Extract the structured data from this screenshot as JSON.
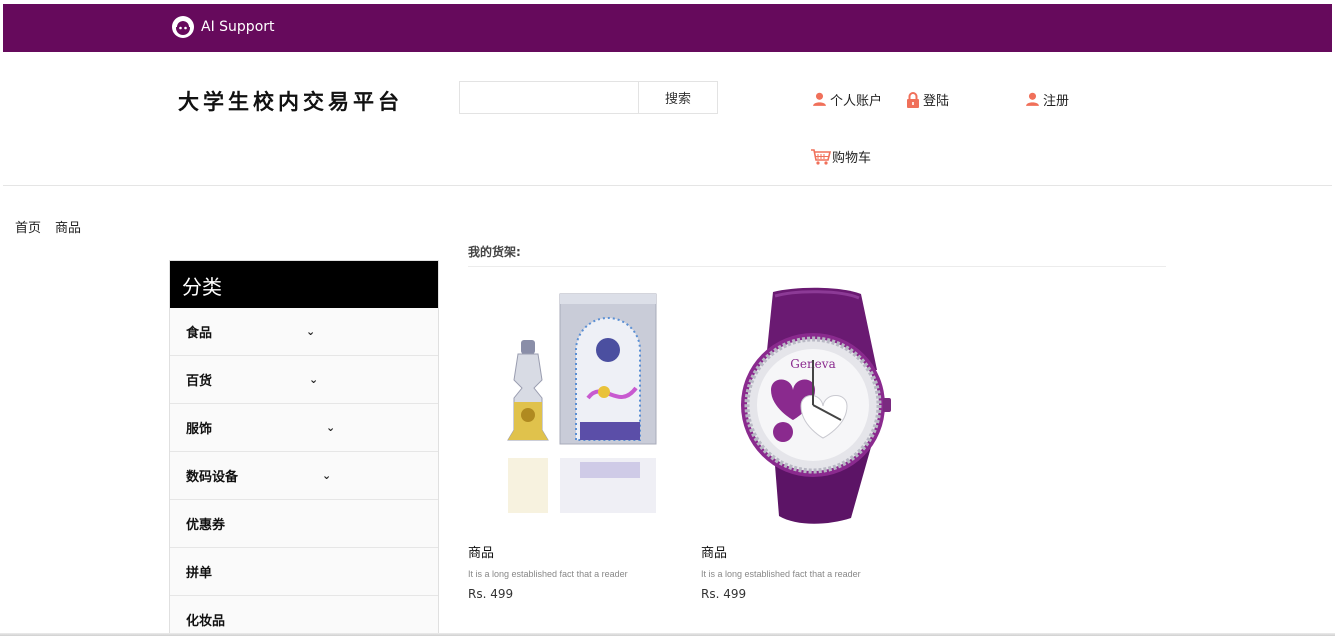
{
  "topbar": {
    "support_label": "AI Support",
    "color": "#660a5c"
  },
  "header": {
    "site_title": "大学生校内交易平台",
    "search": {
      "value": "",
      "placeholder": "",
      "button_label": "搜索"
    },
    "links": {
      "account": "个人账户",
      "login": "登陆",
      "register": "注册",
      "cart": "购物车"
    },
    "icon_color": "#f0705a"
  },
  "breadcrumb": [
    "首页",
    "商品"
  ],
  "sidebar": {
    "title": "分类",
    "items": [
      {
        "label": "食品",
        "has_dropdown": true
      },
      {
        "label": "百货",
        "has_dropdown": true
      },
      {
        "label": "服饰",
        "has_dropdown": true
      },
      {
        "label": "数码设备",
        "has_dropdown": true
      },
      {
        "label": "优惠券",
        "has_dropdown": false
      },
      {
        "label": "拼单",
        "has_dropdown": false
      },
      {
        "label": "化妆品",
        "has_dropdown": false
      }
    ]
  },
  "shelf": {
    "title": "我的货架:",
    "products": [
      {
        "name": "商品",
        "description": "It is a long established fact that a reader",
        "price": "Rs. 499",
        "image": "perfume-bottle-image"
      },
      {
        "name": "商品",
        "description": "It is a long established fact that a reader",
        "price": "Rs. 499",
        "image": "purple-watch-image"
      }
    ]
  }
}
